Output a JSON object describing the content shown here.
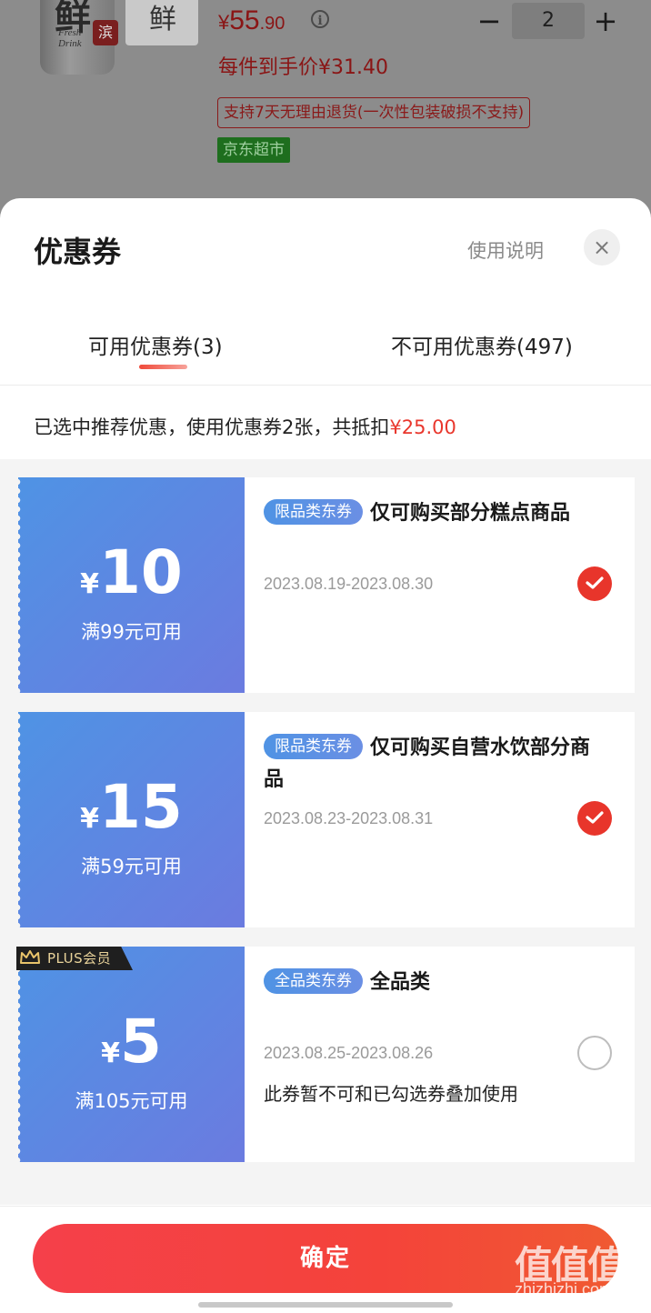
{
  "product": {
    "price_symbol": "¥",
    "price_int": "55",
    "price_dec": ".90",
    "info_icon": "i",
    "quantity": "2",
    "minus_label": "−",
    "plus_label": "+",
    "unit_price": "每件到手价¥31.40",
    "return_policy": "支持7天无理由退货(一次性包装破损不支持)",
    "store_tag": "京东超市",
    "image_label_main": "鲜",
    "image_label_box": "鲜",
    "image_text": "Fresh\nDrink"
  },
  "sheet": {
    "title": "优惠券",
    "help_label": "使用说明",
    "close_icon": "×",
    "tabs": [
      {
        "label": "可用优惠券(3)",
        "active": true
      },
      {
        "label": "不可用优惠券(497)",
        "active": false
      }
    ],
    "summary_prefix": "已选中推荐优惠，使用优惠券2张，共抵扣",
    "summary_amount": "¥25.00"
  },
  "coupons": [
    {
      "currency": "¥",
      "amount": "10",
      "condition": "满99元可用",
      "badge": "限品类东券",
      "title": "仅可购买部分糕点商品",
      "date": "2023.08.19-2023.08.30",
      "note": "",
      "selected": true,
      "plus": false
    },
    {
      "currency": "¥",
      "amount": "15",
      "condition": "满59元可用",
      "badge": "限品类东券",
      "title": "仅可购买自营水饮部分商品",
      "date": "2023.08.23-2023.08.31",
      "note": "",
      "selected": true,
      "plus": false
    },
    {
      "currency": "¥",
      "amount": "5",
      "condition": "满105元可用",
      "badge": "全品类东券",
      "title": "全品类",
      "date": "2023.08.25-2023.08.26",
      "note": "此券暂不可和已勾选券叠加使用",
      "selected": false,
      "plus": true,
      "plus_label": "PLUS会员"
    }
  ],
  "footer": {
    "confirm_label": "确定",
    "watermark": "值值值",
    "watermark_url": "zhizhizhi.com"
  },
  "colors": {
    "accent_red": "#e9372d",
    "coupon_blue": "#5a87e2",
    "store_green": "#1e6e1e"
  }
}
